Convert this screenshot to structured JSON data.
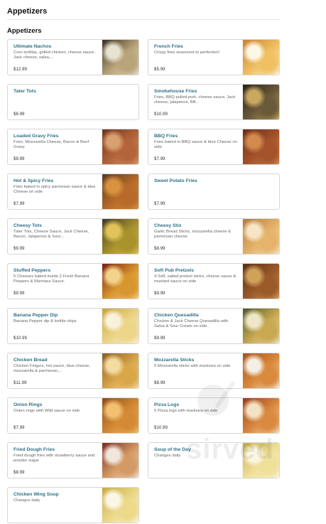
{
  "page": {
    "title": "Appetizers",
    "section_title": "Appetizers"
  },
  "watermark": "sirved",
  "items": [
    {
      "name": "Ultimate Nachos",
      "description": "Corn tortillas, grilled chicken, cheese sauce, Jack cheese, salsa,...",
      "price": "$12.99",
      "image": "nachos",
      "colors": [
        "#3b3222",
        "#b9a47a",
        "#e8e2d0"
      ]
    },
    {
      "name": "French Fries",
      "description": "Crispy fries seasoned to perfection!",
      "price": "$5.99",
      "image": "fries",
      "colors": [
        "#c9802c",
        "#f0c063",
        "#fff7e6"
      ]
    },
    {
      "name": "Tater Tots",
      "description": "",
      "price": "$6.99",
      "image": "",
      "colors": []
    },
    {
      "name": "Smokehouse Fries",
      "description": "Fries, BBQ pulled pork, cheese sauce, Jack cheese, jalapenos, BB...",
      "price": "$10.99",
      "image": "smokehouse-fries",
      "colors": [
        "#2a2018",
        "#6b5a3a",
        "#c9a860"
      ]
    },
    {
      "name": "Loaded Gravy Fries",
      "description": "Fries, Mozzarella Cheese, Bacon & Beef Gravy",
      "price": "$9.99",
      "image": "gravy-fries",
      "colors": [
        "#6e3520",
        "#b4643a",
        "#d9a070"
      ]
    },
    {
      "name": "BBQ Fries",
      "description": "Fries baked in BBQ sauce & blue Cheese on side",
      "price": "$7.99",
      "image": "bbq-fries",
      "colors": [
        "#6a2c16",
        "#a4532a",
        "#d38a4f"
      ]
    },
    {
      "name": "Hot & Spicy Fries",
      "description": "Fries baked in spicy parmesan sauce & blue Cheese on side",
      "price": "$7.99",
      "image": "spicy-fries",
      "colors": [
        "#5a3a22",
        "#b86a2a",
        "#d9933f"
      ]
    },
    {
      "name": "Sweet Potato Fries",
      "description": "",
      "price": "$7.99",
      "image": "",
      "colors": []
    },
    {
      "name": "Cheesy Tots",
      "description": "Tater Tots, Cheese Sauce, Jack Cheese, Bacon, Jalapenos & Sour...",
      "price": "$9.99",
      "image": "cheesy-tots",
      "colors": [
        "#3e3a24",
        "#a8922c",
        "#e1c35a"
      ]
    },
    {
      "name": "Cheesy Stix",
      "description": "Garlic Bread Sticks, mozzarella cheese & parmesan cheese",
      "price": "$8.99",
      "image": "cheesy-stix",
      "colors": [
        "#b57a3a",
        "#e5b36b",
        "#f6e6c6"
      ]
    },
    {
      "name": "Stuffed Peppers",
      "description": "5 Cheeses baked inside 2 Fresh Banana Peppers & Marinara Sauce.",
      "price": "$9.99",
      "image": "stuffed-peppers",
      "colors": [
        "#7a1e12",
        "#d8962e",
        "#f2d38a"
      ]
    },
    {
      "name": "Soft Pub Pretzels",
      "description": "4 Soft, salted pretzel sticks, cheese sauce & mustard sauce on side",
      "price": "$9.99",
      "image": "pretzels",
      "colors": [
        "#5a2c14",
        "#9a5a2a",
        "#d1a25c"
      ]
    },
    {
      "name": "Banana Pepper Dip",
      "description": "Banana Pepper dip & tortilla chips",
      "price": "$10.99",
      "image": "pepper-dip",
      "colors": [
        "#c9a23c",
        "#edd58a",
        "#faf3dc"
      ]
    },
    {
      "name": "Chicken Quesadilla",
      "description": "Chicken & Jack Cheese Quesadilla with Salsa & Sour Cream on side.",
      "price": "$9.99",
      "image": "quesadilla",
      "colors": [
        "#4a5a2a",
        "#c8a850",
        "#efe6c8"
      ]
    },
    {
      "name": "Chicken Bread",
      "description": "Chicken Fingers, hot sauce, blue cheese, mozzarella & parmesan,...",
      "price": "$11.99",
      "image": "chicken-bread",
      "colors": [
        "#8a5a22",
        "#d9a64a",
        "#f3dca0"
      ]
    },
    {
      "name": "Mozzarella Sticks",
      "description": "5 Mozzarella sticks with marinara on side",
      "price": "$8.99",
      "image": "mozzarella-sticks",
      "colors": [
        "#a8501a",
        "#d98a3c",
        "#f5efe6"
      ]
    },
    {
      "name": "Onion Rings",
      "description": "Onion rings with Wild sauce on side",
      "price": "$7.99",
      "image": "onion-rings",
      "colors": [
        "#8a4a16",
        "#d48a34",
        "#f2c070"
      ]
    },
    {
      "name": "Pizza Logs",
      "description": "5 Pizza logs with marinara on side",
      "price": "$10.99",
      "image": "pizza-logs",
      "colors": [
        "#9a3a1a",
        "#d98a40",
        "#f4e2c4"
      ]
    },
    {
      "name": "Fried Dough Fries",
      "description": "Fried dough fries with strawberry sauce and powder sugar",
      "price": "$8.99",
      "image": "dough-fries",
      "colors": [
        "#7a2a22",
        "#d49a64",
        "#f2e6dc"
      ]
    },
    {
      "name": "Soup of the Day",
      "description": "Changes daily",
      "price": "",
      "image": "soup",
      "colors": [
        "#c9b24a",
        "#efe09a",
        "#faf6e2"
      ]
    },
    {
      "name": "Chicken Wing Soup",
      "description": "Changes daily",
      "price": "",
      "image": "wing-soup",
      "colors": [
        "#c7aa40",
        "#ecd98a",
        "#fbf7e6"
      ]
    }
  ]
}
